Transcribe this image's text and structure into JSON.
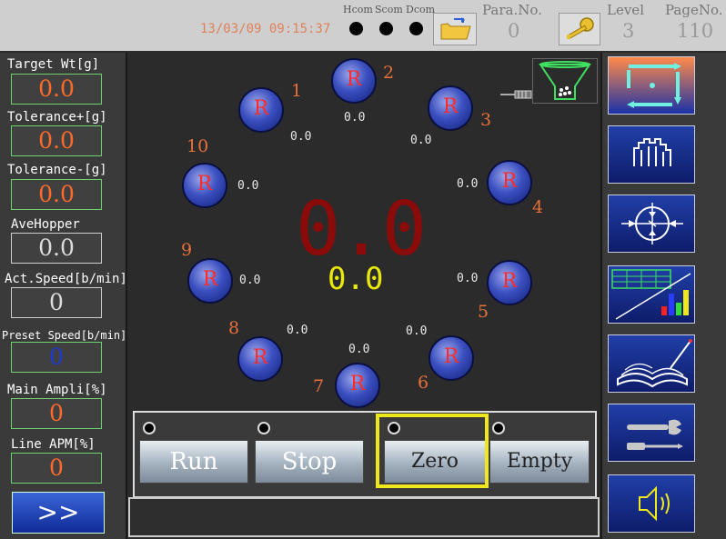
{
  "header": {
    "datetime": "13/03/09 09:15:37",
    "com_labels": [
      "Hcom",
      "Scom",
      "Dcom"
    ],
    "para_no_label": "Para.No.",
    "para_no_value": "0",
    "level_label": "Level",
    "level_value": "3",
    "page_no_label": "PageNo.",
    "page_no_value": "110"
  },
  "left_panel": {
    "target_wt_label": "Target Wt[g]",
    "target_wt_value": "0.0",
    "tol_plus_label": "Tolerance+[g]",
    "tol_plus_value": "0.0",
    "tol_minus_label": "Tolerance-[g]",
    "tol_minus_value": "0.0",
    "ave_hopper_label": "AveHopper",
    "ave_hopper_value": "0.0",
    "act_speed_label": "Act.Speed[b/min]",
    "act_speed_value": "0",
    "preset_speed_label": "Preset Speed[b/min]",
    "preset_speed_value": "0",
    "main_ampli_label": "Main Ampli[%]",
    "main_ampli_value": "0",
    "line_apm_label": "Line APM[%]",
    "line_apm_value": "0",
    "next_button": ">>"
  },
  "center": {
    "main_weight": "0.0",
    "sub_weight": "0.0"
  },
  "hoppers": [
    {
      "number": "1",
      "state": "R",
      "value": "0.0"
    },
    {
      "number": "2",
      "state": "R",
      "value": "0.0"
    },
    {
      "number": "3",
      "state": "R",
      "value": "0.0"
    },
    {
      "number": "4",
      "state": "R",
      "value": "0.0"
    },
    {
      "number": "5",
      "state": "R",
      "value": "0.0"
    },
    {
      "number": "6",
      "state": "R",
      "value": "0.0"
    },
    {
      "number": "7",
      "state": "R",
      "value": "0.0"
    },
    {
      "number": "8",
      "state": "R",
      "value": "0.0"
    },
    {
      "number": "9",
      "state": "R",
      "value": "0.0"
    },
    {
      "number": "10",
      "state": "R",
      "value": "0.0"
    }
  ],
  "controls": {
    "run_label": "Run",
    "stop_label": "Stop",
    "zero_label": "Zero",
    "empty_label": "Empty"
  },
  "colors": {
    "accent_orange": "#e8703a",
    "weight_red": "#8b0a0a",
    "weight_yellow": "#e8e80a",
    "highlight_yellow": "#f0e81a",
    "hopper_blue": "#3b4fc0"
  },
  "right_icons": [
    "cycle-arrows-icon",
    "hopper-bars-icon",
    "crosshair-calibration-icon",
    "bar-chart-icon",
    "manual-book-icon",
    "tools-icon",
    "speaker-icon"
  ]
}
